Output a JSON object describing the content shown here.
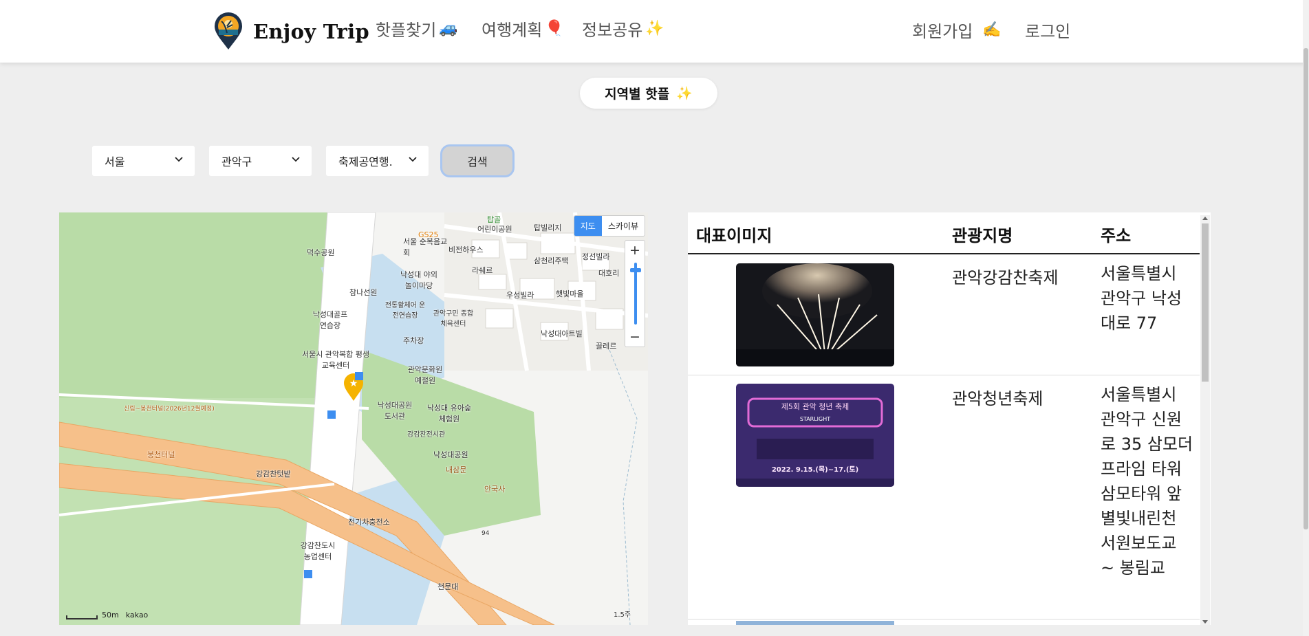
{
  "header": {
    "brand": "Enjoy Trip",
    "nav": [
      {
        "label": "핫플찾기",
        "emoji": "🚙"
      },
      {
        "label": "여행계획",
        "emoji": "🎈"
      },
      {
        "label": "정보공유",
        "emoji": "✨"
      }
    ],
    "signup": {
      "label": "회원가입",
      "emoji": "✍️"
    },
    "login": {
      "label": "로그인"
    }
  },
  "region_badge": {
    "label": "지역별 핫플",
    "emoji": "✨"
  },
  "filters": {
    "sido": "서울",
    "gugun": "관악구",
    "content_type": "축제공연행.",
    "search_label": "검색"
  },
  "map": {
    "type_toggle": [
      "지도",
      "스카이뷰"
    ],
    "zoom_in": "+",
    "zoom_out": "−",
    "scale": "50m",
    "provider": "kakao",
    "labels": [
      "덕수공원",
      "서울 순복음교회",
      "비전하우스",
      "GS25",
      "어린이공원",
      "탑골",
      "탑빌리지",
      "정선빌라",
      "삼천리주택",
      "라쉐르",
      "대호리",
      "낙성대 야외 놀이마당",
      "참나선원",
      "낙성대골프 연습장",
      "전통활체어 운전연습장",
      "관악구민 종합체육센터",
      "우성빌라",
      "햇빛마을",
      "낙성대아트빌",
      "끌레르",
      "주차장",
      "서울시 관악복합 평생교육센터",
      "관악문화원 예절원",
      "낙성대공원 도서관",
      "낙성대 유아숲체험원",
      "강감찬전시관",
      "낙성대공원",
      "내삼문",
      "안국사",
      "신림~봉천터널(2026년12월예정)",
      "봉천터널",
      "강감찬텃밭",
      "전기차충전소",
      "강감찬도시 농업센터",
      "천문대",
      "94",
      "1.5주"
    ]
  },
  "table": {
    "headers": [
      "대표이미지",
      "관광지명",
      "주소"
    ],
    "rows": [
      {
        "name": "관악강감찬축제",
        "address": "서울특별시 관악구 낙성대로 77"
      },
      {
        "name": "관악청년축제",
        "address": "서울특별시 관악구 신원로 35 삼모더 프라임 타워 삼모타워 앞 별빛내린천 서원보도교 ~ 봉림교"
      }
    ],
    "poster_text": {
      "title": "제5회 관악 청년 축제",
      "subtitle": "STARLIGHT",
      "dates": "2022. 9.15.(목)~17.(토)"
    }
  },
  "colors": {
    "accent_blue": "#3d8ef0",
    "page_bg": "#eeeeee",
    "road_orange": "#f6c08a",
    "park_green": "#b6d9a6"
  }
}
